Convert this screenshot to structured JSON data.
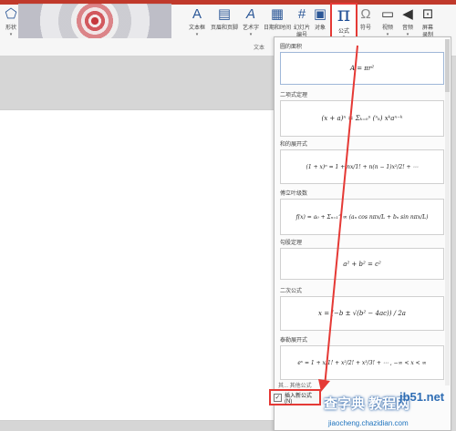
{
  "ribbon": {
    "shapes_label": "形状",
    "textbox_label": "文本框",
    "header_footer_label": "页眉和页脚",
    "wordart_label": "艺术字",
    "datetime_label": "日期和时间",
    "slide_number_label": "幻灯片\n编号",
    "object_label": "对象",
    "formula_label": "公式",
    "symbol_label": "符号",
    "video_label": "视频",
    "audio_label": "音频",
    "screen_record_label": "屏幕\n录制",
    "group_text": "文本"
  },
  "gallery": {
    "items": [
      {
        "title": "圆的面积",
        "formula": "A = πr²"
      },
      {
        "title": "二项式定理",
        "formula": "(x + a)ⁿ = Σₖ₌₀ⁿ (ⁿₖ) xᵏaⁿ⁻ᵏ"
      },
      {
        "title": "和的展开式",
        "formula": "(1 + x)ⁿ = 1 + nx/1! + n(n − 1)x²/2! + ⋯"
      },
      {
        "title": "傅立叶级数",
        "formula": "f(x) = a₀ + Σₙ₌₁^∞ (aₙ cos nπx/L + bₙ sin nπx/L)"
      },
      {
        "title": "勾股定理",
        "formula": "a² + b² = c²"
      },
      {
        "title": "二次公式",
        "formula": "x = (−b ± √(b² − 4ac)) / 2a"
      },
      {
        "title": "泰勒展开式",
        "formula": "eˣ = 1 + x/1! + x²/2! + x³/3! + ⋯ ,   −∞ < x < ∞"
      }
    ],
    "more_label": "其... 其他公式",
    "insert_new_label": "插入新公式(N)"
  },
  "watermark": {
    "main": "查字典 教程网",
    "site": "jiaocheng.chazidian.com",
    "badge": "jb51.net"
  },
  "colors": {
    "highlight": "#e53935",
    "accent_blue": "#1f4e96"
  }
}
